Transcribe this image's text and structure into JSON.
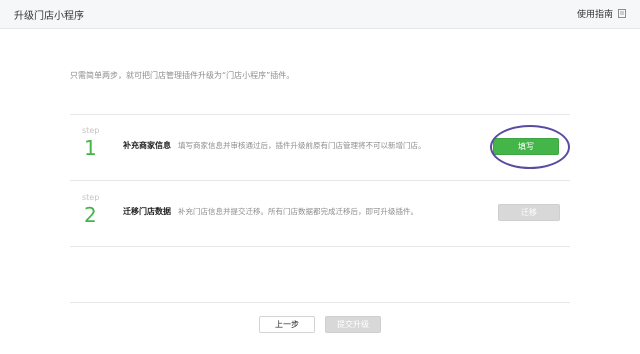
{
  "header": {
    "title": "升级门店小程序",
    "guide_label": "使用指南"
  },
  "intro": "只需简单两步，就可把门店管理插件升级为“门店小程序”插件。",
  "steps": [
    {
      "word": "step",
      "number": "1",
      "title": "补充商家信息",
      "desc": "填写商家信息并审核通过后，插件升级前原有门店管理将不可以新增门店。",
      "button": "填写"
    },
    {
      "word": "step",
      "number": "2",
      "title": "迁移门店数据",
      "desc": "补充门店信息并提交迁移。所有门店数据都完成迁移后，即可升级插件。",
      "button": "迁移"
    }
  ],
  "footer": {
    "prev_label": "上一步",
    "submit_label": "提交升级"
  },
  "colors": {
    "accent_green": "#44b549",
    "annotation_oval": "#5b4aa1"
  }
}
